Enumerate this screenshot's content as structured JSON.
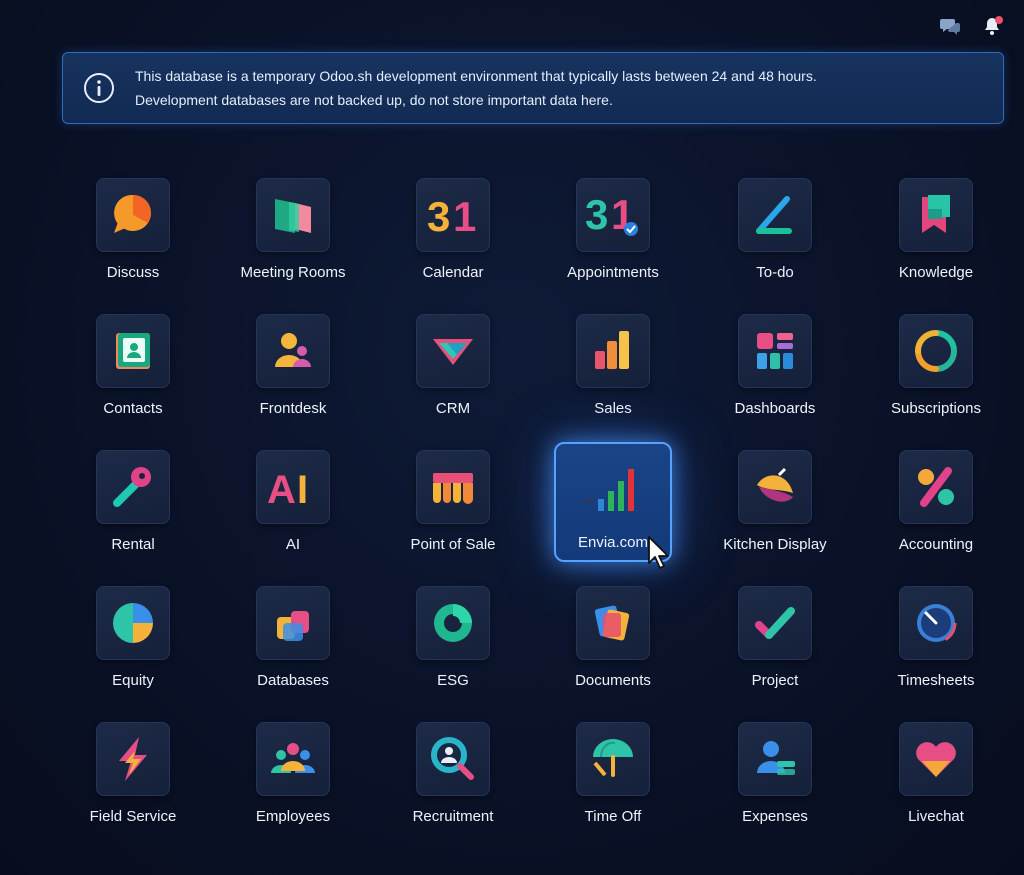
{
  "topbar": {
    "chat_icon": "chat-bubbles-icon",
    "bell_icon": "bell-icon"
  },
  "banner": {
    "icon": "info-icon",
    "line1": "This database is a temporary Odoo.sh development environment that typically lasts between 24 and 48 hours.",
    "line2": "Development databases are not backed up, do not store important data here."
  },
  "apps": [
    {
      "label": "Discuss"
    },
    {
      "label": "Meeting Rooms"
    },
    {
      "label": "Calendar",
      "glyph": "31"
    },
    {
      "label": "Appointments",
      "glyph": "31"
    },
    {
      "label": "To-do"
    },
    {
      "label": "Knowledge"
    },
    {
      "label": "Contacts"
    },
    {
      "label": "Frontdesk"
    },
    {
      "label": "CRM"
    },
    {
      "label": "Sales"
    },
    {
      "label": "Dashboards"
    },
    {
      "label": "Subscriptions"
    },
    {
      "label": "Rental"
    },
    {
      "label": "AI",
      "glyph": "AI"
    },
    {
      "label": "Point of Sale"
    },
    {
      "label": "Envia.com"
    },
    {
      "label": "Kitchen Display"
    },
    {
      "label": "Accounting"
    },
    {
      "label": "Equity"
    },
    {
      "label": "Databases"
    },
    {
      "label": "ESG"
    },
    {
      "label": "Documents"
    },
    {
      "label": "Project"
    },
    {
      "label": "Timesheets"
    },
    {
      "label": "Field Service"
    },
    {
      "label": "Employees"
    },
    {
      "label": "Recruitment"
    },
    {
      "label": "Time Off"
    },
    {
      "label": "Expenses"
    },
    {
      "label": "Livechat"
    }
  ]
}
